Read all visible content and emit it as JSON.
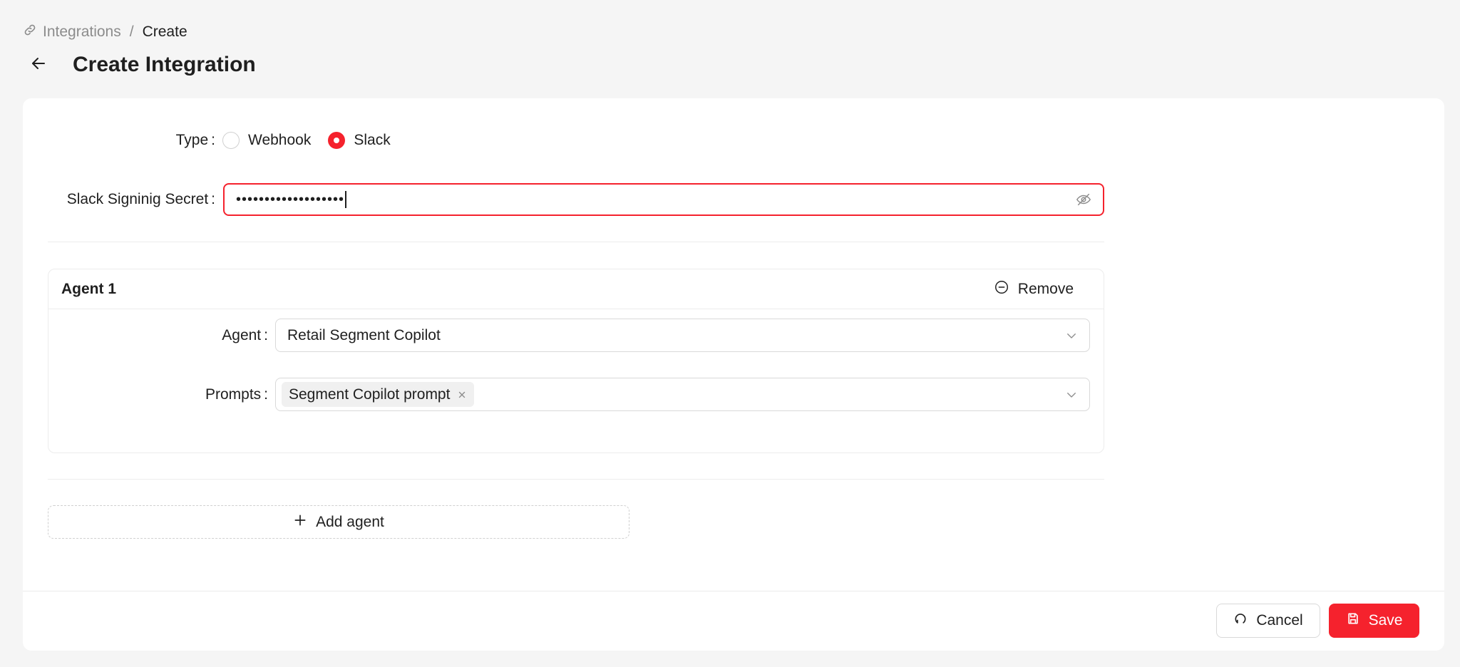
{
  "breadcrumb": {
    "parent": "Integrations",
    "separator": "/",
    "current": "Create"
  },
  "page": {
    "title": "Create Integration"
  },
  "form": {
    "type_label": "Type",
    "type_options": [
      "Webhook",
      "Slack"
    ],
    "type_selected": "Slack",
    "secret_label": "Slack Signinig Secret",
    "secret_value": "•••••••••••••••••••"
  },
  "agent": {
    "title": "Agent 1",
    "remove_label": "Remove",
    "agent_label": "Agent",
    "agent_value": "Retail Segment Copilot",
    "prompts_label": "Prompts",
    "prompt_tags": [
      "Segment Copilot prompt"
    ]
  },
  "actions": {
    "add_agent": "Add agent",
    "cancel": "Cancel",
    "save": "Save"
  },
  "colors": {
    "accent": "#f5222d",
    "border": "#d9d9d9",
    "background": "#f5f5f5"
  },
  "icons": [
    "link-icon",
    "arrow-left-icon",
    "eye-off-icon",
    "minus-circle-icon",
    "chevron-down-icon",
    "close-icon",
    "plus-icon",
    "reload-icon",
    "save-icon"
  ]
}
